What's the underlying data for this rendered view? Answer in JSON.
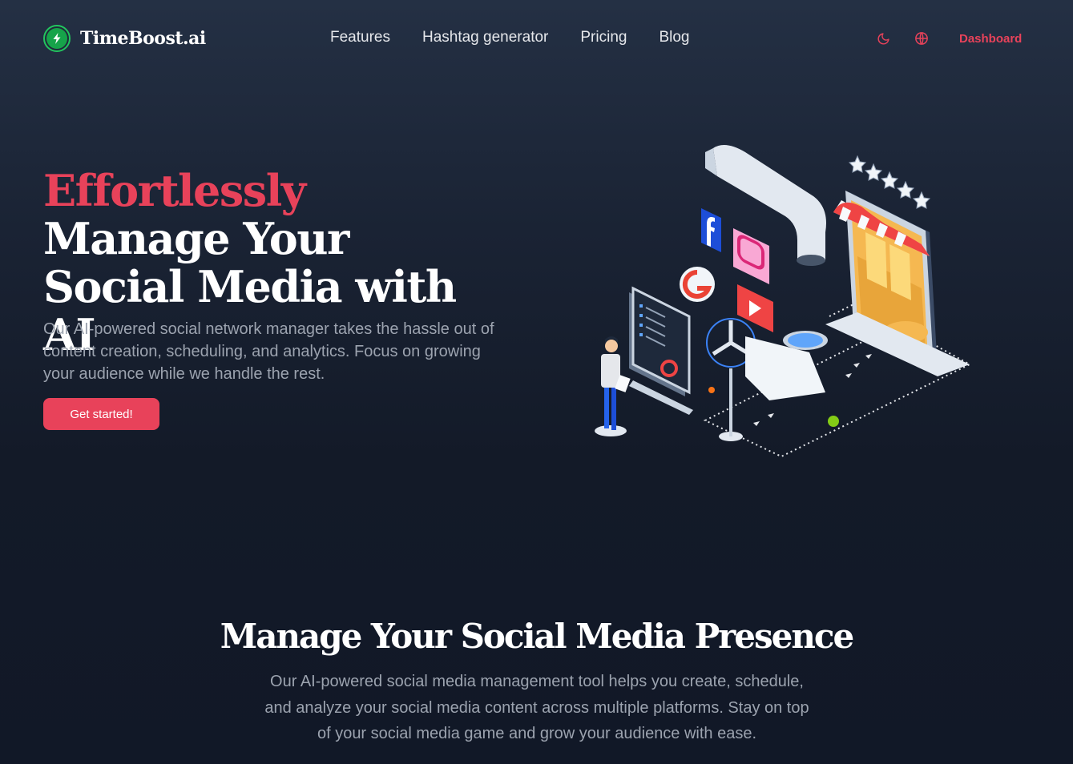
{
  "brand": {
    "name": "TimeBoost.ai",
    "logo_icon": "lightning-bolt-icon",
    "accent_color": "#e8425a",
    "logo_color": "#22c55e"
  },
  "nav": {
    "items": [
      {
        "label": "Features"
      },
      {
        "label": "Hashtag generator"
      },
      {
        "label": "Pricing"
      },
      {
        "label": "Blog"
      }
    ],
    "theme_icon": "moon-icon",
    "language_icon": "globe-icon",
    "dashboard_label": "Dashboard"
  },
  "hero": {
    "title_accent": "Effortlessly",
    "title_rest": " Manage Your Social Media with AI",
    "subtitle": "Our AI-powered social network manager takes the hassle out of content creation, scheduling, and analytics. Focus on growing your audience while we handle the rest.",
    "cta_label": "Get started!"
  },
  "section_manage": {
    "title": "Manage Your Social Media Presence",
    "subtitle": "Our AI-powered social media management tool helps you create, schedule, and analyze your social media content across multiple platforms. Stay on top of your social media game and grow your audience with ease."
  }
}
